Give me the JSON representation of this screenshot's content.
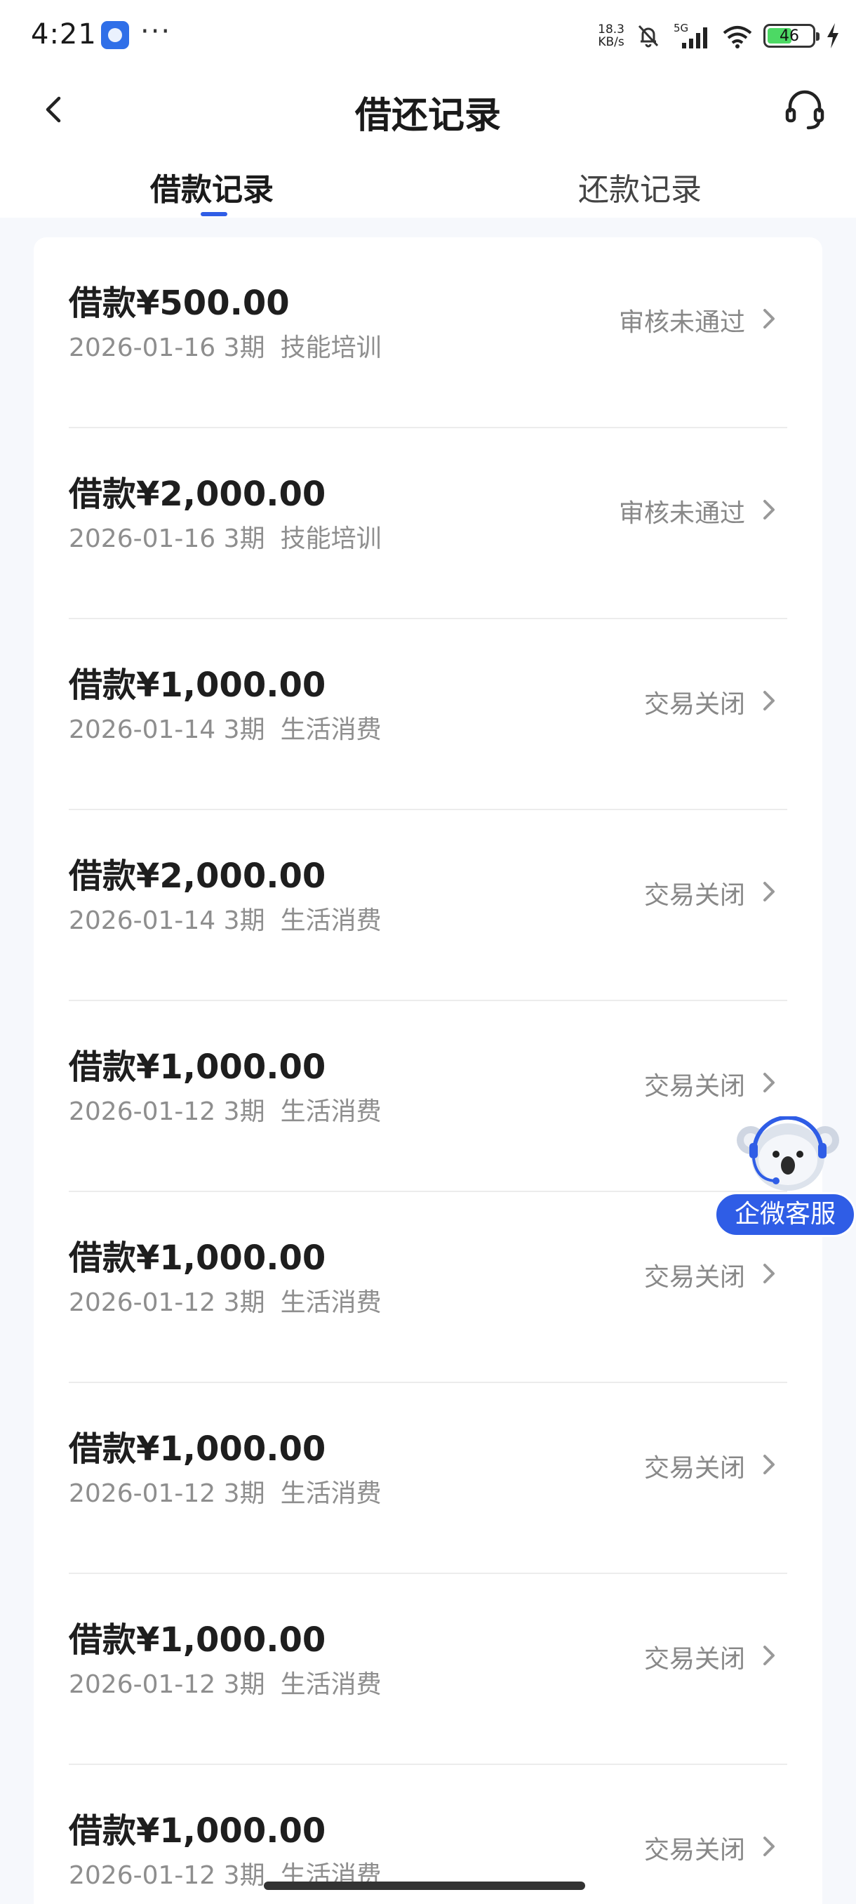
{
  "status_bar": {
    "time": "4:21",
    "dots": "···",
    "speed_value": "18.3",
    "speed_unit": "KB/s",
    "network": "5G",
    "battery": "46",
    "icons": [
      "app-icon",
      "bell-muted-icon",
      "signal-icon",
      "wifi-icon",
      "battery-icon",
      "charging-icon"
    ]
  },
  "header": {
    "title": "借还记录",
    "back_icon": "chevron-left-icon",
    "service_icon": "headset-icon"
  },
  "tabs": {
    "active": "借款记录",
    "inactive": "还款记录"
  },
  "records": [
    {
      "amount": "借款¥500.00",
      "date_term": "2026-01-16 3期",
      "purpose": "技能培训",
      "status": "审核未通过"
    },
    {
      "amount": "借款¥2,000.00",
      "date_term": "2026-01-16 3期",
      "purpose": "技能培训",
      "status": "审核未通过"
    },
    {
      "amount": "借款¥1,000.00",
      "date_term": "2026-01-14 3期",
      "purpose": "生活消费",
      "status": "交易关闭"
    },
    {
      "amount": "借款¥2,000.00",
      "date_term": "2026-01-14 3期",
      "purpose": "生活消费",
      "status": "交易关闭"
    },
    {
      "amount": "借款¥1,000.00",
      "date_term": "2026-01-12 3期",
      "purpose": "生活消费",
      "status": "交易关闭"
    },
    {
      "amount": "借款¥1,000.00",
      "date_term": "2026-01-12 3期",
      "purpose": "生活消费",
      "status": "交易关闭"
    },
    {
      "amount": "借款¥1,000.00",
      "date_term": "2026-01-12 3期",
      "purpose": "生活消费",
      "status": "交易关闭"
    },
    {
      "amount": "借款¥1,000.00",
      "date_term": "2026-01-12 3期",
      "purpose": "生活消费",
      "status": "交易关闭"
    },
    {
      "amount": "借款¥1,000.00",
      "date_term": "2026-01-12 3期",
      "purpose": "生活消费",
      "status": "交易关闭"
    }
  ],
  "floating_service": {
    "label": "企微客服",
    "icon": "koala-mascot-icon"
  },
  "colors": {
    "accent": "#2f5de6",
    "page_bg": "#f6f8fc",
    "muted_text": "#8e8e8e"
  }
}
